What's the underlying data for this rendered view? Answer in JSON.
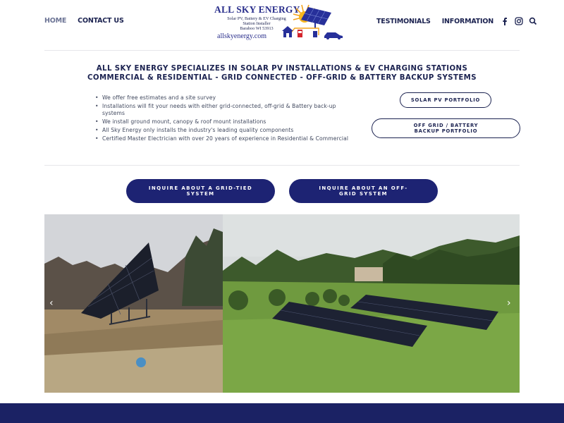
{
  "nav": {
    "home": "HOME",
    "contact": "CONTACT US",
    "testimonials": "TESTIMONIALS",
    "information": "INFORMATION"
  },
  "logo": {
    "title": "ALL SKY ENERGY",
    "line1": "Solar PV, Battery & EV Charging",
    "line2": "Station Installer",
    "line3": "Baraboo WI 53913",
    "url": "allskyenergy.com"
  },
  "headline": {
    "line1": "ALL SKY ENERGY SPECIALIZES IN SOLAR PV INSTALLATIONS & EV CHARGING STATIONS",
    "line2": "COMMERCIAL & RESIDENTIAL - GRID CONNECTED - OFF-GRID & BATTERY BACKUP SYSTEMS"
  },
  "bullets": [
    "We offer free estimates and a site survey",
    "Installations will fit your needs with either grid-connected, off-grid & Battery back-up systems",
    "We install ground mount, canopy & roof mount installations",
    "All Sky Energy only installs the industry's leading quality components",
    "Certified Master Electrician with over 20 years of experience in Residential & Commercial"
  ],
  "buttons": {
    "portfolio": "SOLAR PV PORTFOLIO",
    "offgrid": "OFF GRID / BATTERY BACKUP PORTFOLIO",
    "inquire_grid": "INQUIRE ABOUT A GRID-TIED SYSTEM",
    "inquire_off": "INQUIRE ABOUT AN OFF-GRID SYSTEM"
  },
  "slider": {
    "prev": "‹",
    "next": "›"
  },
  "colors": {
    "navy": "#1b2250",
    "button_fill": "#1d2373",
    "footer": "#1b2264"
  },
  "icons": [
    "facebook-icon",
    "instagram-icon",
    "search-icon",
    "chevron-left-icon",
    "chevron-right-icon"
  ]
}
